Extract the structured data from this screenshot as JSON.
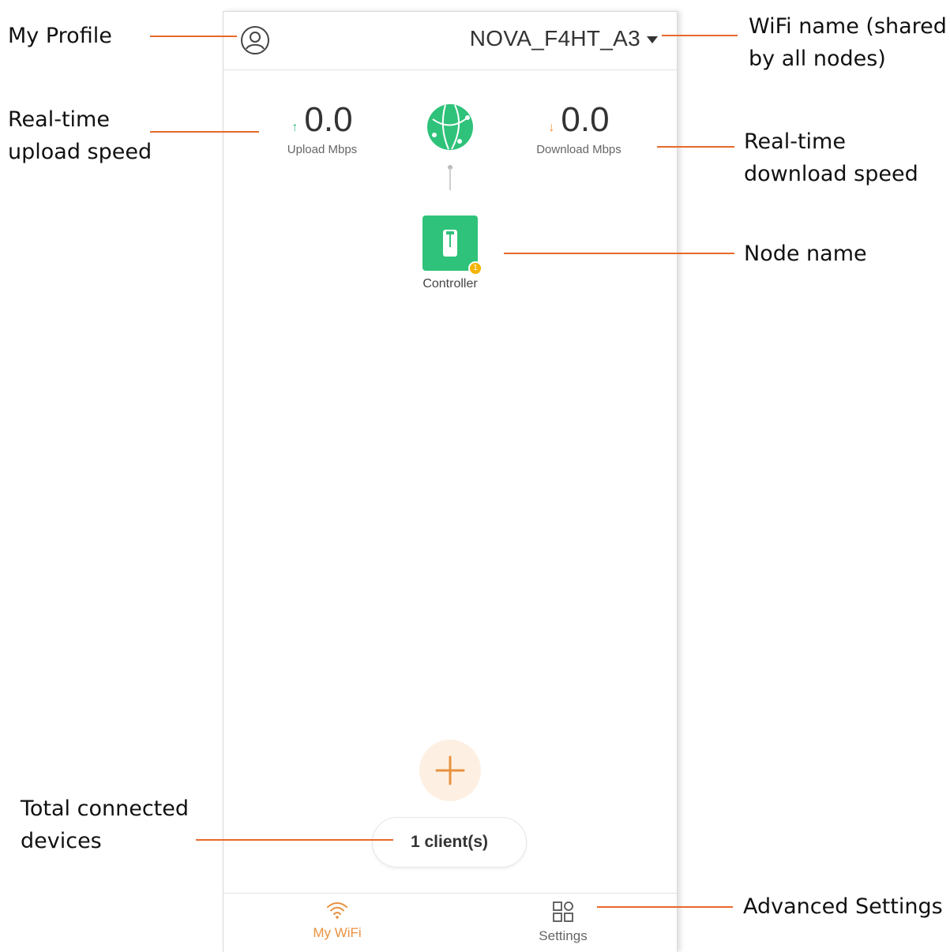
{
  "header": {
    "wifi_name": "NOVA_F4HT_A3"
  },
  "speeds": {
    "upload_value": "0.0",
    "upload_label": "Upload Mbps",
    "download_value": "0.0",
    "download_label": "Download Mbps"
  },
  "node": {
    "name": "Controller",
    "badge": "1"
  },
  "clients": {
    "label": "1 client(s)"
  },
  "tabs": {
    "my_wifi": "My WiFi",
    "settings": "Settings"
  },
  "callouts": {
    "my_profile": "My Profile",
    "wifi_name_line1": "WiFi name (shared",
    "wifi_name_line2": "by all nodes)",
    "upload_line1": "Real-time",
    "upload_line2": "upload speed",
    "download_line1": "Real-time",
    "download_line2": "download speed",
    "node_name": "Node name",
    "total_line1": "Total connected",
    "total_line2": "devices",
    "advanced": "Advanced Settings"
  },
  "colors": {
    "accent_orange": "#e8913f",
    "brand_green": "#2fc27a",
    "callout_line": "#e8692a"
  }
}
